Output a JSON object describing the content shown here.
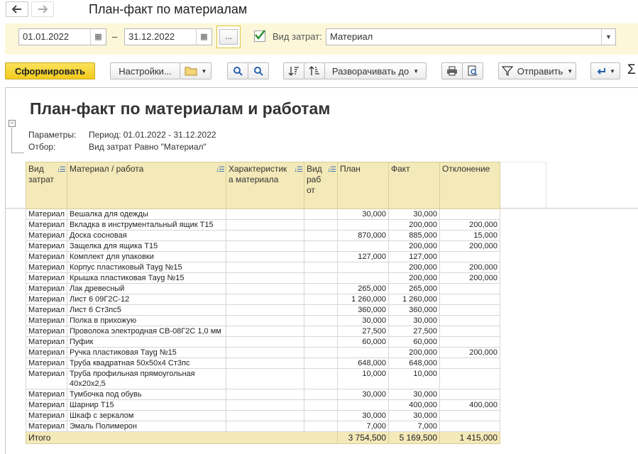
{
  "window": {
    "title": "План-факт по материалам"
  },
  "filters": {
    "date_from": "01.01.2022",
    "date_to": "31.12.2022",
    "dash": "–",
    "period_btn": "...",
    "cost_type_label": "Вид затрат:",
    "cost_type_value": "Материал",
    "cost_type_checked": true
  },
  "toolbar": {
    "generate": "Сформировать",
    "settings": "Настройки...",
    "expand_to": "Разворачивать до",
    "send": "Отправить",
    "sum_symbol": "Σ"
  },
  "report": {
    "title": "План-факт по материалам и работам",
    "params_label": "Параметры:",
    "params_value": "Период: 01.01.2022 - 31.12.2022",
    "filter_label": "Отбор:",
    "filter_value": "Вид затрат Равно \"Материал\"",
    "columns": [
      "Вид затрат",
      "Материал / работа",
      "Характеристика материала",
      "Вид работ",
      "План",
      "Факт",
      "Отклонение"
    ],
    "rows": [
      [
        "Материал",
        "Вешалка для одежды",
        "",
        "",
        "30,000",
        "30,000",
        ""
      ],
      [
        "Материал",
        "Вкладка в инструментальный ящик Т15",
        "",
        "",
        "",
        "200,000",
        "200,000"
      ],
      [
        "Материал",
        "Доска сосновая",
        "",
        "",
        "870,000",
        "885,000",
        "15,000"
      ],
      [
        "Материал",
        "Защелка для ящика Т15",
        "",
        "",
        "",
        "200,000",
        "200,000"
      ],
      [
        "Материал",
        "Комплект для упаковки",
        "",
        "",
        "127,000",
        "127,000",
        ""
      ],
      [
        "Материал",
        "Корпус пластиковый Тауg №15",
        "",
        "",
        "",
        "200,000",
        "200,000"
      ],
      [
        "Материал",
        "Крышка пластиковая Тауg №15",
        "",
        "",
        "",
        "200,000",
        "200,000"
      ],
      [
        "Материал",
        "Лак древесный",
        "",
        "",
        "265,000",
        "265,000",
        ""
      ],
      [
        "Материал",
        "Лист 6 09Г2С-12",
        "",
        "",
        "1 260,000",
        "1 260,000",
        ""
      ],
      [
        "Материал",
        "Лист 6 Ст3пс5",
        "",
        "",
        "360,000",
        "360,000",
        ""
      ],
      [
        "Материал",
        "Полка в прихожую",
        "",
        "",
        "30,000",
        "30,000",
        ""
      ],
      [
        "Материал",
        "Проволока электродная СВ-08Г2С 1,0 мм",
        "",
        "",
        "27,500",
        "27,500",
        ""
      ],
      [
        "Материал",
        "Пуфик",
        "",
        "",
        "60,000",
        "60,000",
        ""
      ],
      [
        "Материал",
        "Ручка пластиковая Тауg №15",
        "",
        "",
        "",
        "200,000",
        "200,000"
      ],
      [
        "Материал",
        "Труба квадратная 50х50х4 Ст3пс",
        "",
        "",
        "648,000",
        "648,000",
        ""
      ],
      [
        "Материал",
        "Труба профильная прямоугольная 40х20х2,5",
        "",
        "",
        "10,000",
        "10,000",
        ""
      ],
      [
        "Материал",
        "Тумбочка под обувь",
        "",
        "",
        "30,000",
        "30,000",
        ""
      ],
      [
        "Материал",
        "Шарнир Т15",
        "",
        "",
        "",
        "400,000",
        "400,000"
      ],
      [
        "Материал",
        "Шкаф с зеркалом",
        "",
        "",
        "30,000",
        "30,000",
        ""
      ],
      [
        "Материал",
        "Эмаль Полимерон",
        "",
        "",
        "7,000",
        "7,000",
        ""
      ]
    ],
    "total": {
      "label": "Итого",
      "plan": "3 754,500",
      "fact": "5 169,500",
      "deviation": "1 415,000"
    }
  }
}
